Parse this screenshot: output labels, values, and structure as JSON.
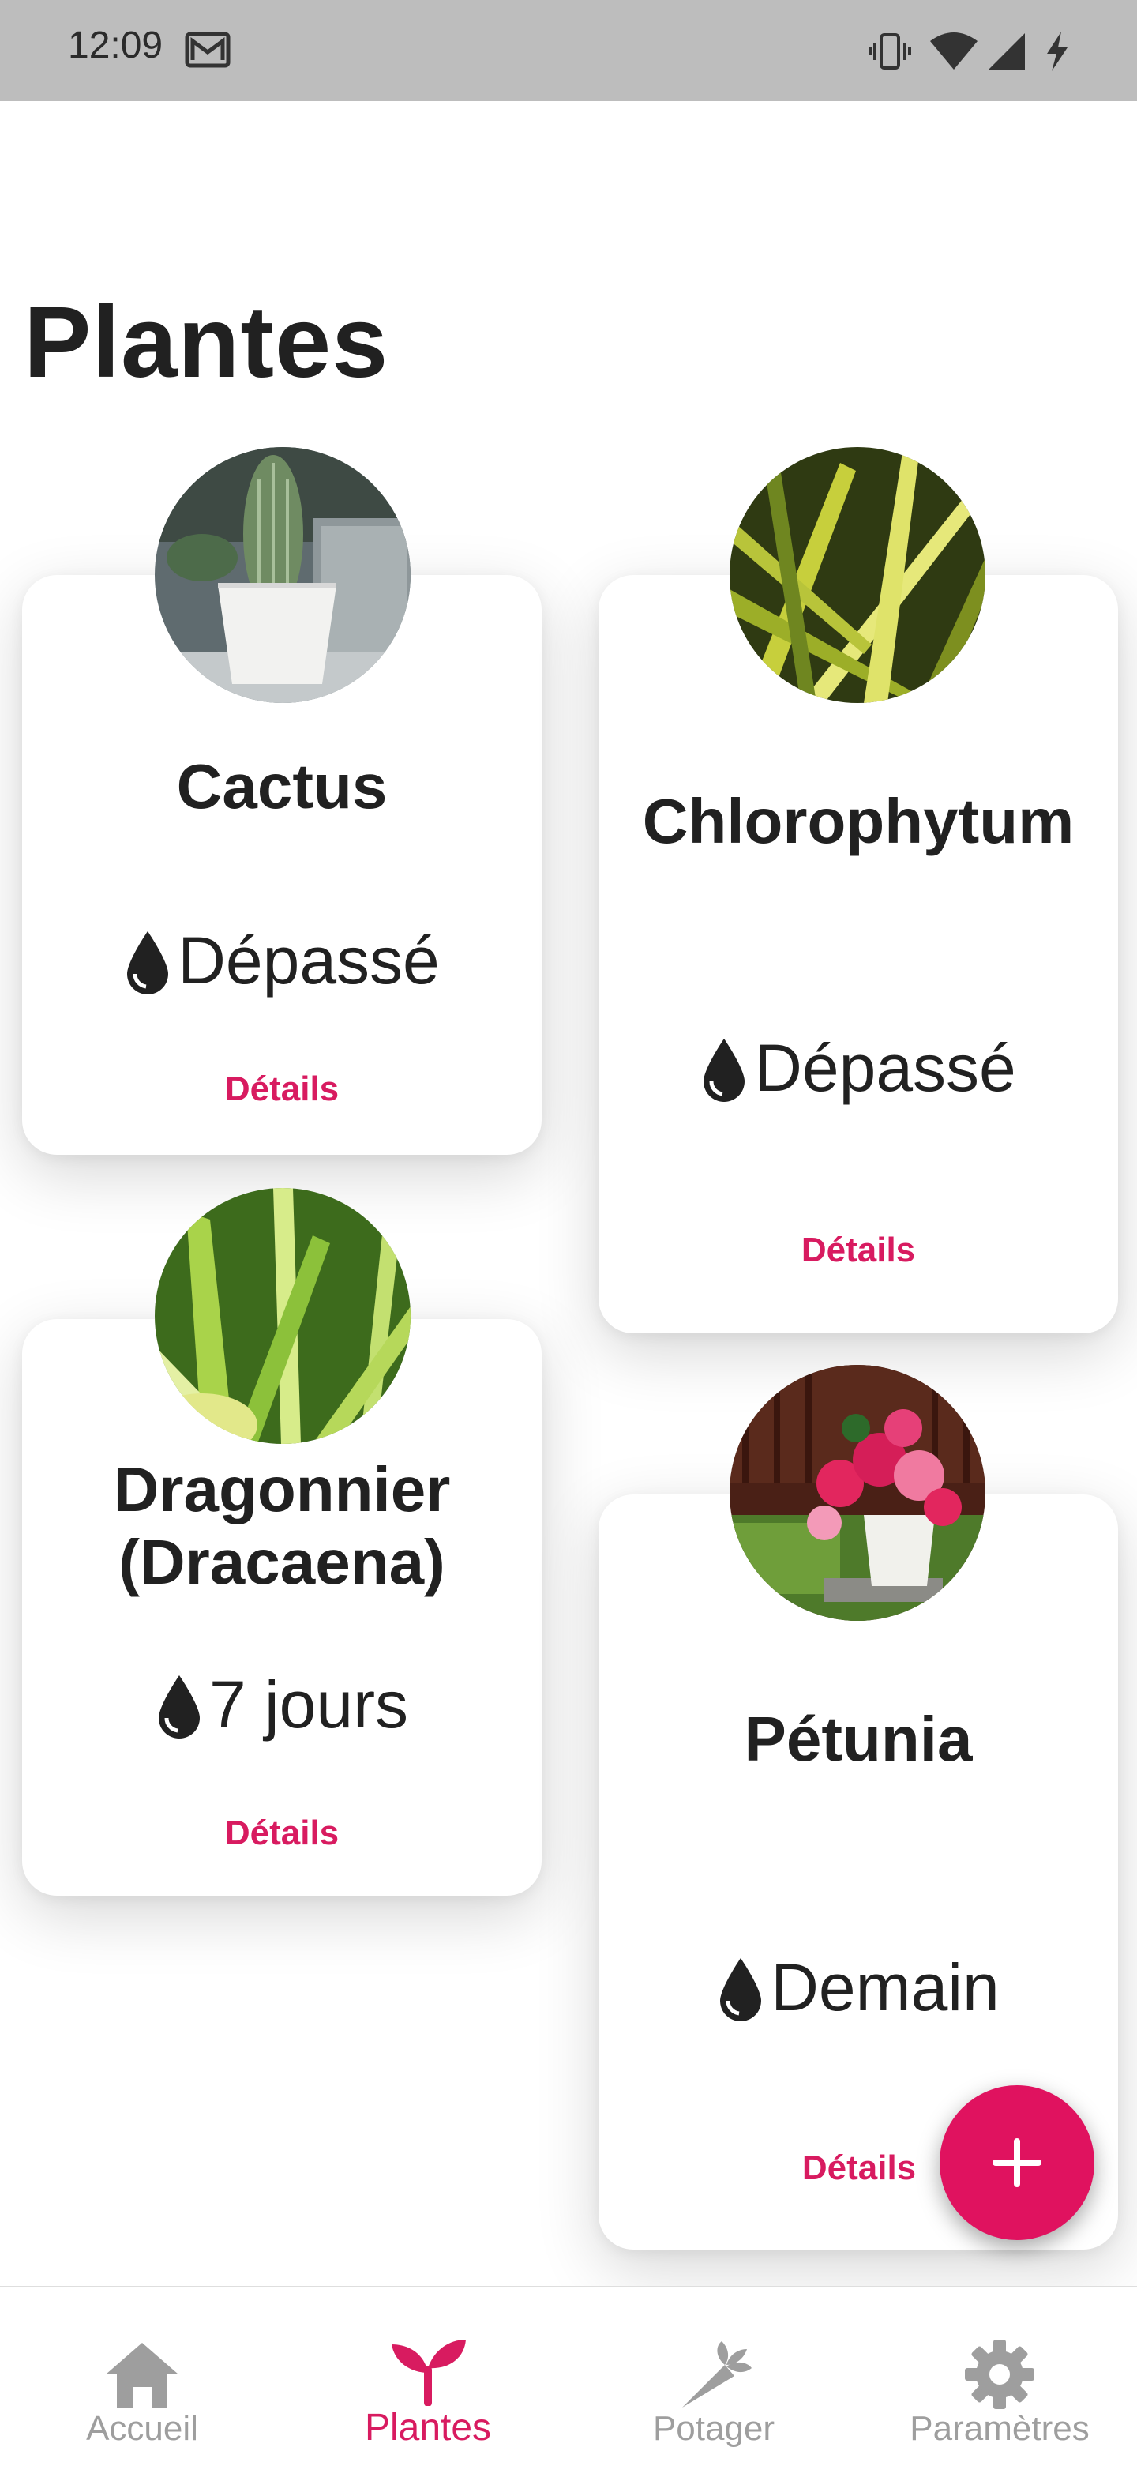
{
  "status_bar": {
    "time": "12:09"
  },
  "page": {
    "title": "Plantes"
  },
  "plants": [
    {
      "name": "Cactus",
      "watering": "Dépassé",
      "details_label": "Détails"
    },
    {
      "name": "Chlorophytum",
      "watering": "Dépassé",
      "details_label": "Détails"
    },
    {
      "name_line1": "Dragonnier",
      "name_line2": "(Dracaena)",
      "watering": "7 jours",
      "details_label": "Détails"
    },
    {
      "name": "Pétunia",
      "watering": "Demain",
      "details_label": "Détails"
    }
  ],
  "fab": {
    "icon": "plus-icon"
  },
  "bottom_nav": {
    "items": [
      {
        "label": "Accueil",
        "icon": "home-icon"
      },
      {
        "label": "Plantes",
        "icon": "sprout-icon",
        "active": true
      },
      {
        "label": "Potager",
        "icon": "carrot-icon"
      },
      {
        "label": "Paramètres",
        "icon": "gear-icon"
      }
    ]
  },
  "colors": {
    "accent": "#d81b60",
    "fab": "#e0125f",
    "inactive": "#9e9e9e",
    "status_bar": "#bdbdbd"
  }
}
